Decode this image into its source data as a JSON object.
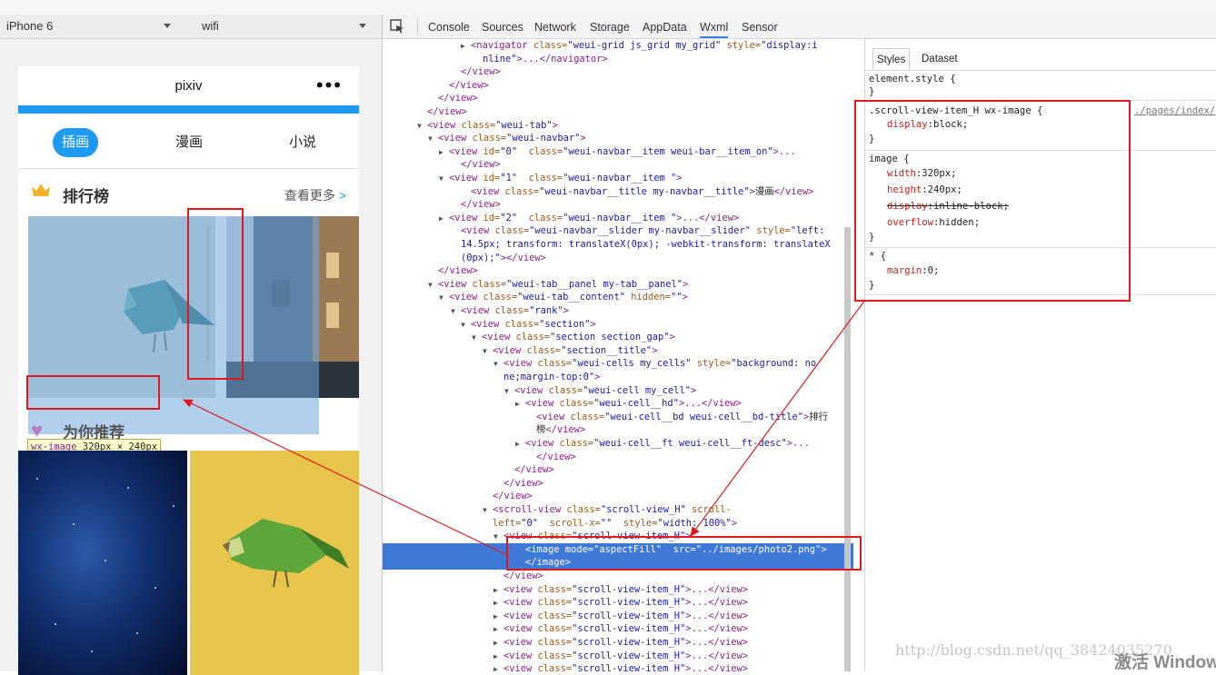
{
  "simulator": {
    "device": "iPhone 6",
    "network": "wifi",
    "nav_title": "pixiv",
    "more_glyph": "•••",
    "tabs": [
      "插画",
      "漫画",
      "小说"
    ],
    "rank_title": "排行榜",
    "see_more": "查看更多",
    "see_more_arrow": ">",
    "recommend_title": "为你推荐",
    "tooltip_tag": "wx-image",
    "tooltip_size": "320px × 240px"
  },
  "devtools": {
    "tabs": [
      "Console",
      "Sources",
      "Network",
      "Storage",
      "AppData",
      "Wxml",
      "Sensor"
    ],
    "active_tab": "Wxml",
    "styles_tabs": [
      "Styles",
      "Dataset"
    ]
  },
  "wxml_lines": [
    {
      "i": 97,
      "t": "▶",
      "p": [
        [
          "tg",
          "<navigator "
        ],
        [
          "an",
          "class="
        ],
        [
          "av",
          "\"weui-grid js_grid my_grid\""
        ],
        [
          "an",
          " style="
        ],
        [
          "av",
          "\"display:i"
        ]
      ]
    },
    {
      "i": 110,
      "t": "",
      "p": [
        [
          "av",
          "nline\""
        ],
        [
          "tg",
          ">...</navigator>"
        ]
      ]
    },
    {
      "i": 86,
      "t": "",
      "p": [
        [
          "tg",
          "</view>"
        ]
      ]
    },
    {
      "i": 73,
      "t": "",
      "p": [
        [
          "tg",
          "</view>"
        ]
      ]
    },
    {
      "i": 61,
      "t": "",
      "p": [
        [
          "tg",
          "</view>"
        ]
      ]
    },
    {
      "i": 49,
      "t": "",
      "p": [
        [
          "tg",
          "</view>"
        ]
      ]
    },
    {
      "i": 49,
      "t": "▼",
      "p": [
        [
          "tg",
          "<view "
        ],
        [
          "an",
          "class="
        ],
        [
          "av",
          "\"weui-tab\""
        ],
        [
          "tg",
          ">"
        ]
      ]
    },
    {
      "i": 61,
      "t": "▼",
      "p": [
        [
          "tg",
          "<view "
        ],
        [
          "an",
          "class="
        ],
        [
          "av",
          "\"weui-navbar\""
        ],
        [
          "tg",
          ">"
        ]
      ]
    },
    {
      "i": 73,
      "t": "▶",
      "p": [
        [
          "tg",
          "<view "
        ],
        [
          "an",
          "id="
        ],
        [
          "av",
          "\"0\" "
        ],
        [
          "an",
          " class="
        ],
        [
          "av",
          "\"weui-navbar__item weui-bar__item_on\""
        ],
        [
          "tg",
          ">..."
        ]
      ]
    },
    {
      "i": 86,
      "t": "",
      "p": [
        [
          "tg",
          "</view>"
        ]
      ]
    },
    {
      "i": 73,
      "t": "▼",
      "p": [
        [
          "tg",
          "<view "
        ],
        [
          "an",
          "id="
        ],
        [
          "av",
          "\"1\" "
        ],
        [
          "an",
          " class="
        ],
        [
          "av",
          "\"weui-navbar__item \""
        ],
        [
          "tg",
          ">"
        ]
      ]
    },
    {
      "i": 97,
      "t": "",
      "p": [
        [
          "tg",
          "<view "
        ],
        [
          "an",
          "class="
        ],
        [
          "av",
          "\"weui-navbar__title my-navbar__title\""
        ],
        [
          "tg",
          ">"
        ],
        [
          "tx",
          "漫画"
        ],
        [
          "tg",
          "</view>"
        ]
      ]
    },
    {
      "i": 86,
      "t": "",
      "p": [
        [
          "tg",
          "</view>"
        ]
      ]
    },
    {
      "i": 73,
      "t": "▶",
      "p": [
        [
          "tg",
          "<view "
        ],
        [
          "an",
          "id="
        ],
        [
          "av",
          "\"2\" "
        ],
        [
          "an",
          " class="
        ],
        [
          "av",
          "\"weui-navbar__item \""
        ],
        [
          "tg",
          ">...</view>"
        ]
      ]
    },
    {
      "i": 86,
      "t": "",
      "p": [
        [
          "tg",
          "<view "
        ],
        [
          "an",
          "class="
        ],
        [
          "av",
          "\"weui-navbar__slider my-navbar__slider\""
        ],
        [
          "an",
          " style="
        ],
        [
          "av",
          "\"left:"
        ]
      ]
    },
    {
      "i": 86,
      "t": "",
      "p": [
        [
          "av",
          "14.5px; transform: translateX(0px); -webkit-transform: translateX"
        ]
      ]
    },
    {
      "i": 86,
      "t": "",
      "p": [
        [
          "av",
          "(0px);\""
        ],
        [
          "tg",
          "></view>"
        ]
      ]
    },
    {
      "i": 61,
      "t": "",
      "p": [
        [
          "tg",
          "</view>"
        ]
      ]
    },
    {
      "i": 61,
      "t": "▼",
      "p": [
        [
          "tg",
          "<view "
        ],
        [
          "an",
          "class="
        ],
        [
          "av",
          "\"weui-tab__panel my-tab__panel\""
        ],
        [
          "tg",
          ">"
        ]
      ]
    },
    {
      "i": 73,
      "t": "▼",
      "p": [
        [
          "tg",
          "<view "
        ],
        [
          "an",
          "class="
        ],
        [
          "av",
          "\"weui-tab__content\""
        ],
        [
          "an",
          " hidden="
        ],
        [
          "av",
          "\"\""
        ],
        [
          "tg",
          ">"
        ]
      ]
    },
    {
      "i": 86,
      "t": "▼",
      "p": [
        [
          "tg",
          "<view "
        ],
        [
          "an",
          "class="
        ],
        [
          "av",
          "\"rank\""
        ],
        [
          "tg",
          ">"
        ]
      ]
    },
    {
      "i": 97,
      "t": "▼",
      "p": [
        [
          "tg",
          "<view "
        ],
        [
          "an",
          "class="
        ],
        [
          "av",
          "\"section\""
        ],
        [
          "tg",
          ">"
        ]
      ]
    },
    {
      "i": 109,
      "t": "▼",
      "p": [
        [
          "tg",
          "<view "
        ],
        [
          "an",
          "class="
        ],
        [
          "av",
          "\"section section_gap\""
        ],
        [
          "tg",
          ">"
        ]
      ]
    },
    {
      "i": 121,
      "t": "▼",
      "p": [
        [
          "tg",
          "<view "
        ],
        [
          "an",
          "class="
        ],
        [
          "av",
          "\"section__title\""
        ],
        [
          "tg",
          ">"
        ]
      ]
    },
    {
      "i": 133,
      "t": "▼",
      "p": [
        [
          "tg",
          "<view "
        ],
        [
          "an",
          "class="
        ],
        [
          "av",
          "\"weui-cells my_cells\""
        ],
        [
          "an",
          " style="
        ],
        [
          "av",
          "\"background: no"
        ]
      ]
    },
    {
      "i": 133,
      "t": "",
      "p": [
        [
          "av",
          "ne;margin-top:0\""
        ],
        [
          "tg",
          ">"
        ]
      ]
    },
    {
      "i": 145,
      "t": "▼",
      "p": [
        [
          "tg",
          "<view "
        ],
        [
          "an",
          "class="
        ],
        [
          "av",
          "\"weui-cell my_cell\""
        ],
        [
          "tg",
          ">"
        ]
      ]
    },
    {
      "i": 157,
      "t": "▶",
      "p": [
        [
          "tg",
          "<view "
        ],
        [
          "an",
          "class="
        ],
        [
          "av",
          "\"weui-cell__hd\""
        ],
        [
          "tg",
          ">...</view>"
        ]
      ]
    },
    {
      "i": 169,
      "t": "",
      "p": [
        [
          "tg",
          "<view "
        ],
        [
          "an",
          "class="
        ],
        [
          "av",
          "\"weui-cell__bd weui-cell__bd-title\""
        ],
        [
          "tg",
          ">"
        ],
        [
          "tx",
          "排行"
        ]
      ]
    },
    {
      "i": 169,
      "t": "",
      "p": [
        [
          "tx",
          "榜"
        ],
        [
          "tg",
          "</view>"
        ]
      ]
    },
    {
      "i": 157,
      "t": "▶",
      "p": [
        [
          "tg",
          "<view "
        ],
        [
          "an",
          "class="
        ],
        [
          "av",
          "\"weui-cell__ft weui-cell__ft-desc\""
        ],
        [
          "tg",
          ">..."
        ]
      ]
    },
    {
      "i": 169,
      "t": "",
      "p": [
        [
          "tg",
          "</view>"
        ]
      ]
    },
    {
      "i": 145,
      "t": "",
      "p": [
        [
          "tg",
          "</view>"
        ]
      ]
    },
    {
      "i": 133,
      "t": "",
      "p": [
        [
          "tg",
          "</view>"
        ]
      ]
    },
    {
      "i": 121,
      "t": "",
      "p": [
        [
          "tg",
          "</view>"
        ]
      ]
    },
    {
      "i": 121,
      "t": "▼",
      "p": [
        [
          "tg",
          "<scroll-view "
        ],
        [
          "an",
          "class="
        ],
        [
          "av",
          "\"scroll-view_H\""
        ],
        [
          "an",
          " scroll-"
        ]
      ]
    },
    {
      "i": 121,
      "t": "",
      "p": [
        [
          "an",
          "left="
        ],
        [
          "av",
          "\"0\" "
        ],
        [
          "an",
          " scroll-x="
        ],
        [
          "av",
          "\"\" "
        ],
        [
          "an",
          " style="
        ],
        [
          "av",
          "\"width: 100%\""
        ],
        [
          "tg",
          ">"
        ]
      ]
    },
    {
      "i": 133,
      "t": "▼",
      "p": [
        [
          "tg",
          "<view "
        ],
        [
          "an",
          "class="
        ],
        [
          "av",
          "\"scroll-view-item_H\""
        ],
        [
          "tg",
          ">"
        ]
      ]
    },
    {
      "i": 157,
      "t": "",
      "sel": true,
      "p": [
        [
          "tg",
          "<image "
        ],
        [
          "an",
          "mode="
        ],
        [
          "av",
          "\"aspectFill\" "
        ],
        [
          "an",
          " src="
        ],
        [
          "av",
          "\"../images/photo2.png\""
        ],
        [
          "tg",
          ">"
        ]
      ]
    },
    {
      "i": 157,
      "t": "",
      "sel": true,
      "p": [
        [
          "tg",
          "</image>"
        ]
      ]
    },
    {
      "i": 133,
      "t": "",
      "p": [
        [
          "tg",
          "</view>"
        ]
      ]
    },
    {
      "i": 133,
      "t": "▶",
      "p": [
        [
          "tg",
          "<view "
        ],
        [
          "an",
          "class="
        ],
        [
          "av",
          "\"scroll-view-item_H\""
        ],
        [
          "tg",
          ">...</view>"
        ]
      ]
    },
    {
      "i": 133,
      "t": "▶",
      "p": [
        [
          "tg",
          "<view "
        ],
        [
          "an",
          "class="
        ],
        [
          "av",
          "\"scroll-view-item_H\""
        ],
        [
          "tg",
          ">...</view>"
        ]
      ]
    },
    {
      "i": 133,
      "t": "▶",
      "p": [
        [
          "tg",
          "<view "
        ],
        [
          "an",
          "class="
        ],
        [
          "av",
          "\"scroll-view-item_H\""
        ],
        [
          "tg",
          ">...</view>"
        ]
      ]
    },
    {
      "i": 133,
      "t": "▶",
      "p": [
        [
          "tg",
          "<view "
        ],
        [
          "an",
          "class="
        ],
        [
          "av",
          "\"scroll-view-item_H\""
        ],
        [
          "tg",
          ">...</view>"
        ]
      ]
    },
    {
      "i": 133,
      "t": "▶",
      "p": [
        [
          "tg",
          "<view "
        ],
        [
          "an",
          "class="
        ],
        [
          "av",
          "\"scroll-view-item_H\""
        ],
        [
          "tg",
          ">...</view>"
        ]
      ]
    },
    {
      "i": 133,
      "t": "▶",
      "p": [
        [
          "tg",
          "<view "
        ],
        [
          "an",
          "class="
        ],
        [
          "av",
          "\"scroll-view-item_H\""
        ],
        [
          "tg",
          ">...</view>"
        ]
      ]
    },
    {
      "i": 133,
      "t": "▶",
      "p": [
        [
          "tg",
          "<view "
        ],
        [
          "an",
          "class="
        ],
        [
          "av",
          "\"scroll-view-item_H\""
        ],
        [
          "tg",
          ">...</view>"
        ]
      ]
    }
  ],
  "styles": {
    "element_style": "element.style {",
    "close": "}",
    "rule1_selector": ".scroll-view-item_H wx-image {",
    "rule1_source": "./pages/index/",
    "rule1_props": [
      {
        "p": "display",
        "v": "block;"
      }
    ],
    "rule2_selector": "image {",
    "rule2_props": [
      {
        "p": "width",
        "v": "320px;"
      },
      {
        "p": "height",
        "v": "240px;"
      },
      {
        "p": "display",
        "v": "inline-block;",
        "struck": true
      },
      {
        "p": "overflow",
        "v": "hidden;"
      }
    ],
    "rule3_selector": "* {",
    "rule3_props": [
      {
        "p": "margin",
        "v": "0;"
      }
    ]
  },
  "watermark": "http://blog.csdn.net/qq_38424035270",
  "windows_activation": "激活 Windows",
  "colors": {
    "accent": "#1e9af2",
    "highlight": "#3e79d8",
    "annotation": "#e0191e"
  }
}
